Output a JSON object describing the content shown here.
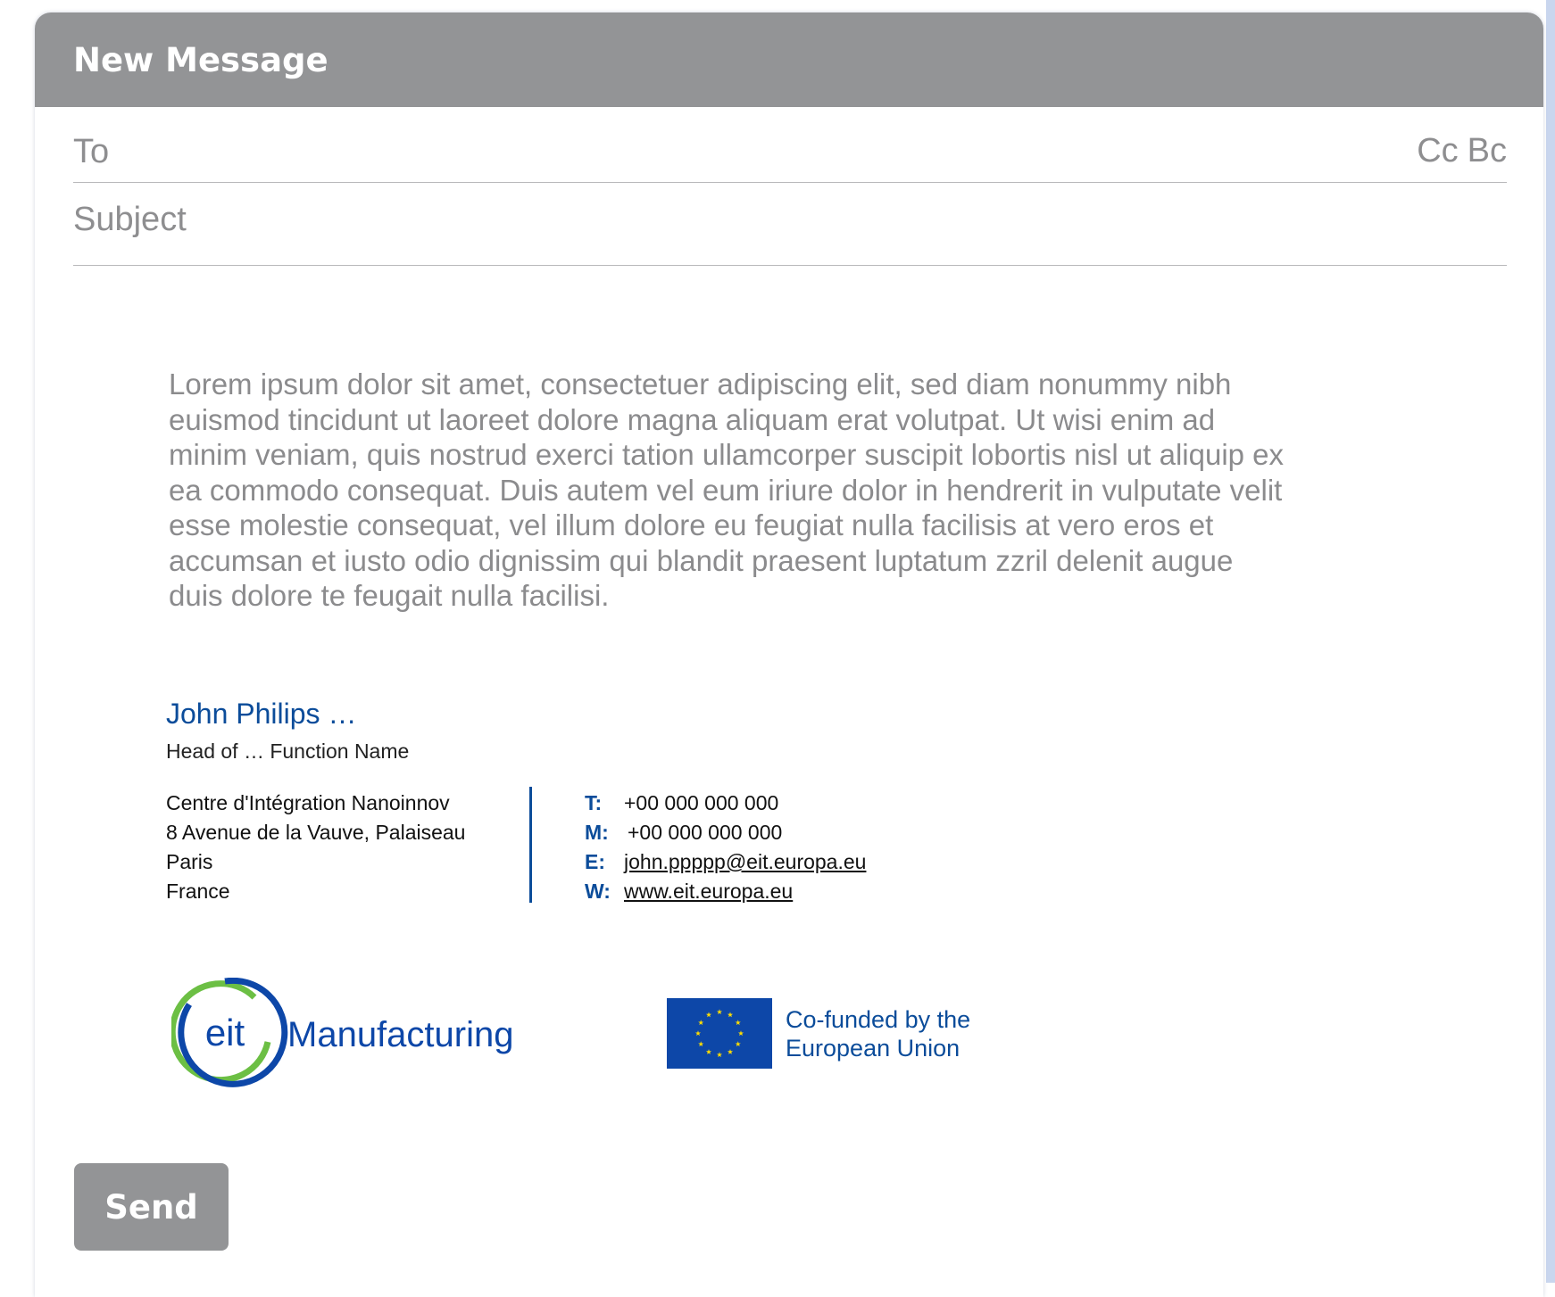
{
  "window": {
    "title": "New Message"
  },
  "compose": {
    "to_placeholder": "To",
    "cc_label": "Cc",
    "bcc_label": "Bc",
    "subject_placeholder": "Subject",
    "body_text": "Lorem ipsum dolor sit amet, consectetuer adipiscing elit, sed diam nonummy nibh euismod tincidunt ut laoreet dolore magna aliquam erat volutpat. Ut wisi enim ad minim veniam, quis nostrud exerci tation ullamcorper suscipit lobortis nisl ut aliquip ex ea commodo consequat. Duis autem vel eum iriure dolor in hendrerit in vulputate velit esse molestie consequat, vel illum dolore eu feugiat nulla facilisis at vero eros et accumsan et iusto odio dignissim qui blandit praesent luptatum zzril delenit augue duis dolore te feugait nulla facilisi."
  },
  "signature": {
    "name": "John Philips …",
    "function": "Head of … Function Name",
    "address": {
      "line1": "Centre d'Intégration Nanoinnov",
      "line2": "8 Avenue de la Vauve, Palaiseau",
      "city": "Paris",
      "country": "France"
    },
    "contacts": {
      "phone_key": "T:",
      "phone": "+00 000 000 000",
      "mobile_key": "M:",
      "mobile": "+00 000 000 000",
      "email_key": "E:",
      "email": "john.ppppp@eit.europa.eu",
      "web_key": "W:",
      "web": "www.eit.europa.eu"
    },
    "logos": {
      "eit_mark": "eit",
      "eit_word": "Manufacturing",
      "eu_line1": "Co-funded by the",
      "eu_line2": "European Union"
    }
  },
  "actions": {
    "send_label": "Send"
  },
  "colors": {
    "header_gray": "#939496",
    "signature_blue": "#0b4c9a",
    "eit_green": "#6cbf44",
    "eu_blue": "#0d47a8",
    "eu_star": "#ffdd00"
  }
}
